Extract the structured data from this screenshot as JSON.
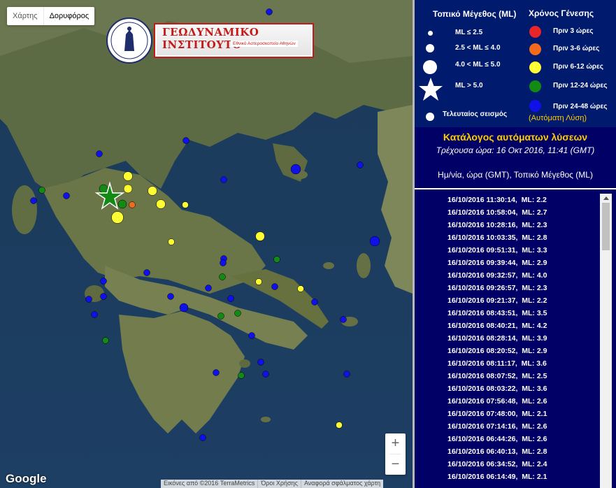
{
  "map": {
    "map_types": [
      "Χάρτης",
      "Δορυφόρος"
    ],
    "active_map_type": "Δορυφόρος",
    "logo_title": "ΓΕΩΔΥΝΑΜΙΚΟ ΙΝΣΤΙΤΟΥΤΟ",
    "logo_subtitle": "Εθνικό Αστεροσκοπείο Αθηνών",
    "zoom_in": "+",
    "zoom_out": "−",
    "google": "Google",
    "attribution": [
      "Εικόνες από ©2016 TerraMetrics",
      "Όροι Χρήσης",
      "Αναφορά σφάλματος χάρτη"
    ]
  },
  "legend": {
    "magnitude_title": "Τοπικό Μέγεθος (ML)",
    "magnitudes": [
      "ML ≤ 2.5",
      "2.5 < ML ≤ 4.0",
      "4.0 < ML ≤ 5.0",
      "ML > 5.0"
    ],
    "last_event": "Τελευταίος σεισμός",
    "time_title": "Χρόνος Γένεσης",
    "times": [
      {
        "label": "Πριν 3 ώρες",
        "color": "#e8262a"
      },
      {
        "label": "Πριν 3-6 ώρες",
        "color": "#f26b1d"
      },
      {
        "label": "Πριν 6-12 ώρες",
        "color": "#ffff33"
      },
      {
        "label": "Πριν 12-24 ώρες",
        "color": "#138a13"
      },
      {
        "label": "Πριν 24-48 ώρες",
        "color": "#1010e8"
      }
    ],
    "auto_solution": "(Αυτόματη Λύση)"
  },
  "catalog": {
    "title": "Κατάλογος αυτόματων λύσεων",
    "current_time": "Τρέχουσα ώρα: 16 Οκτ 2016, 11:41 (GMT)",
    "header": "Ημ/νία, ώρα (GMT), Τοπικό Μέγεθος (ML)",
    "rows": [
      "16/10/2016 11:30:14,  ML: 2.2",
      "16/10/2016 10:58:04,  ML: 2.7",
      "16/10/2016 10:28:16,  ML: 2.3",
      "16/10/2016 10:03:35,  ML: 2.8",
      "16/10/2016 09:51:31,  ML: 3.3",
      "16/10/2016 09:39:44,  ML: 2.9",
      "16/10/2016 09:32:57,  ML: 4.0",
      "16/10/2016 09:26:57,  ML: 2.3",
      "16/10/2016 09:21:37,  ML: 2.2",
      "16/10/2016 08:43:51,  ML: 3.5",
      "16/10/2016 08:40:21,  ML: 4.2",
      "16/10/2016 08:28:14,  ML: 3.9",
      "16/10/2016 08:20:52,  ML: 2.9",
      "16/10/2016 08:11:17,  ML: 3.6",
      "16/10/2016 08:07:52,  ML: 2.5",
      "16/10/2016 08:03:22,  ML: 3.6",
      "16/10/2016 07:56:48,  ML: 2.6",
      "16/10/2016 07:48:00,  ML: 2.1",
      "16/10/2016 07:14:16,  ML: 2.6",
      "16/10/2016 06:44:26,  ML: 2.6",
      "16/10/2016 06:40:13,  ML: 2.8",
      "16/10/2016 06:34:52,  ML: 2.4",
      "16/10/2016 06:14:49,  ML: 2.1"
    ]
  },
  "events": [
    {
      "age": "12-24",
      "size": "4.0-5.0",
      "c": "#138a13"
    },
    {
      "age": "12-24",
      "size": "4.0-5.0",
      "c": "#138a13"
    },
    {
      "age": "6-12",
      "size": "4.0-5.0",
      "c": "#ffff33"
    },
    {
      "age": "3-6",
      "size": "2.5-4.0",
      "c": "#f26b1d"
    }
  ]
}
